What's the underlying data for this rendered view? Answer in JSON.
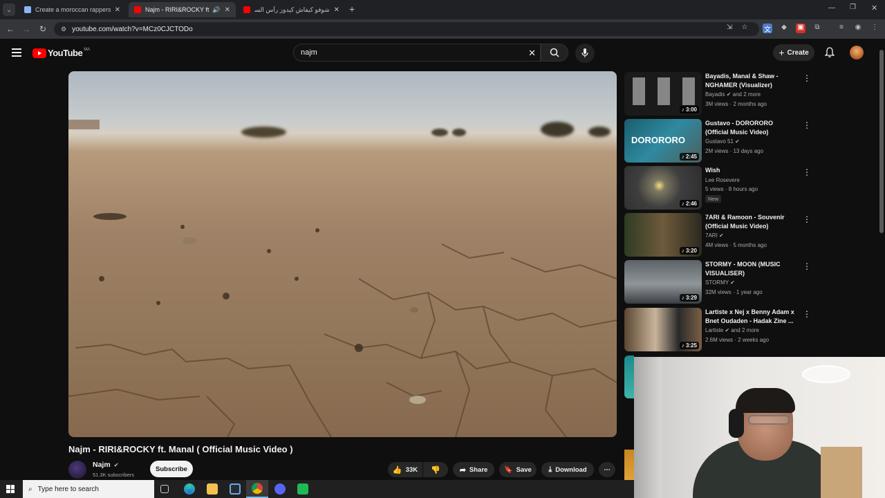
{
  "browser": {
    "tabs": [
      {
        "title": "Create a moroccan rappers Tie",
        "active": false
      },
      {
        "title": "Najm - RIRI&ROCKY ft. Ma",
        "active": true
      },
      {
        "title": "شوفو كيفاش كيدوز رأس السنة فـ",
        "active": false
      }
    ],
    "url": "youtube.com/watch?v=MCz0CJCTODo"
  },
  "youtube": {
    "logo_text": "YouTube",
    "region": "MA",
    "search_value": "najm",
    "create_label": "Create"
  },
  "video": {
    "title": "Najm - RIRI&ROCKY ft. Manal ( Official Music Video )",
    "channel": "Najm",
    "subscribers": "51.3K subscribers",
    "subscribe_label": "Subscribe",
    "likes": "33K",
    "share_label": "Share",
    "save_label": "Save",
    "download_label": "Download"
  },
  "recommendations": [
    {
      "title": "Bayadis, Manal & Shaw - NGHAMER (Visualizer)",
      "channel": "Bayadis",
      "channel_suffix": "and 2 more",
      "views": "3M views · 2 months ago",
      "duration": "3:00",
      "verified": true,
      "badge": ""
    },
    {
      "title": "Gustavo - DORORORO (Official Music Video)",
      "channel": "Gustavo 51",
      "channel_suffix": "",
      "views": "2M views · 13 days ago",
      "duration": "2:45",
      "verified": true,
      "badge": ""
    },
    {
      "title": "Wish",
      "channel": "Lee Rosevere",
      "channel_suffix": "",
      "views": "5 views · 8 hours ago",
      "duration": "2:46",
      "verified": false,
      "badge": "New"
    },
    {
      "title": "7ARI & Ramoon - Souvenir (Official Music Video)",
      "channel": "7ARI",
      "channel_suffix": "",
      "views": "4M views · 5 months ago",
      "duration": "3:20",
      "verified": true,
      "badge": ""
    },
    {
      "title": "STORMY - MOON (MUSIC VISUALISER)",
      "channel": "STORMY",
      "channel_suffix": "",
      "views": "32M views · 1 year ago",
      "duration": "3:29",
      "verified": true,
      "badge": ""
    },
    {
      "title": "Lartiste x Nej x Benny Adam x Bnet Oudaden - Hadak Zine ...",
      "channel": "Lartiste",
      "channel_suffix": "and 2 more",
      "views": "2.6M views · 2 weeks ago",
      "duration": "3:25",
      "verified": true,
      "badge": ""
    }
  ],
  "thumb_text": {
    "dorororo": "DORORORO"
  },
  "taskbar": {
    "search_placeholder": "Type here to search"
  },
  "colors": {
    "brand_red": "#ff0000",
    "bg": "#0f0f0f",
    "chip": "#272727"
  }
}
